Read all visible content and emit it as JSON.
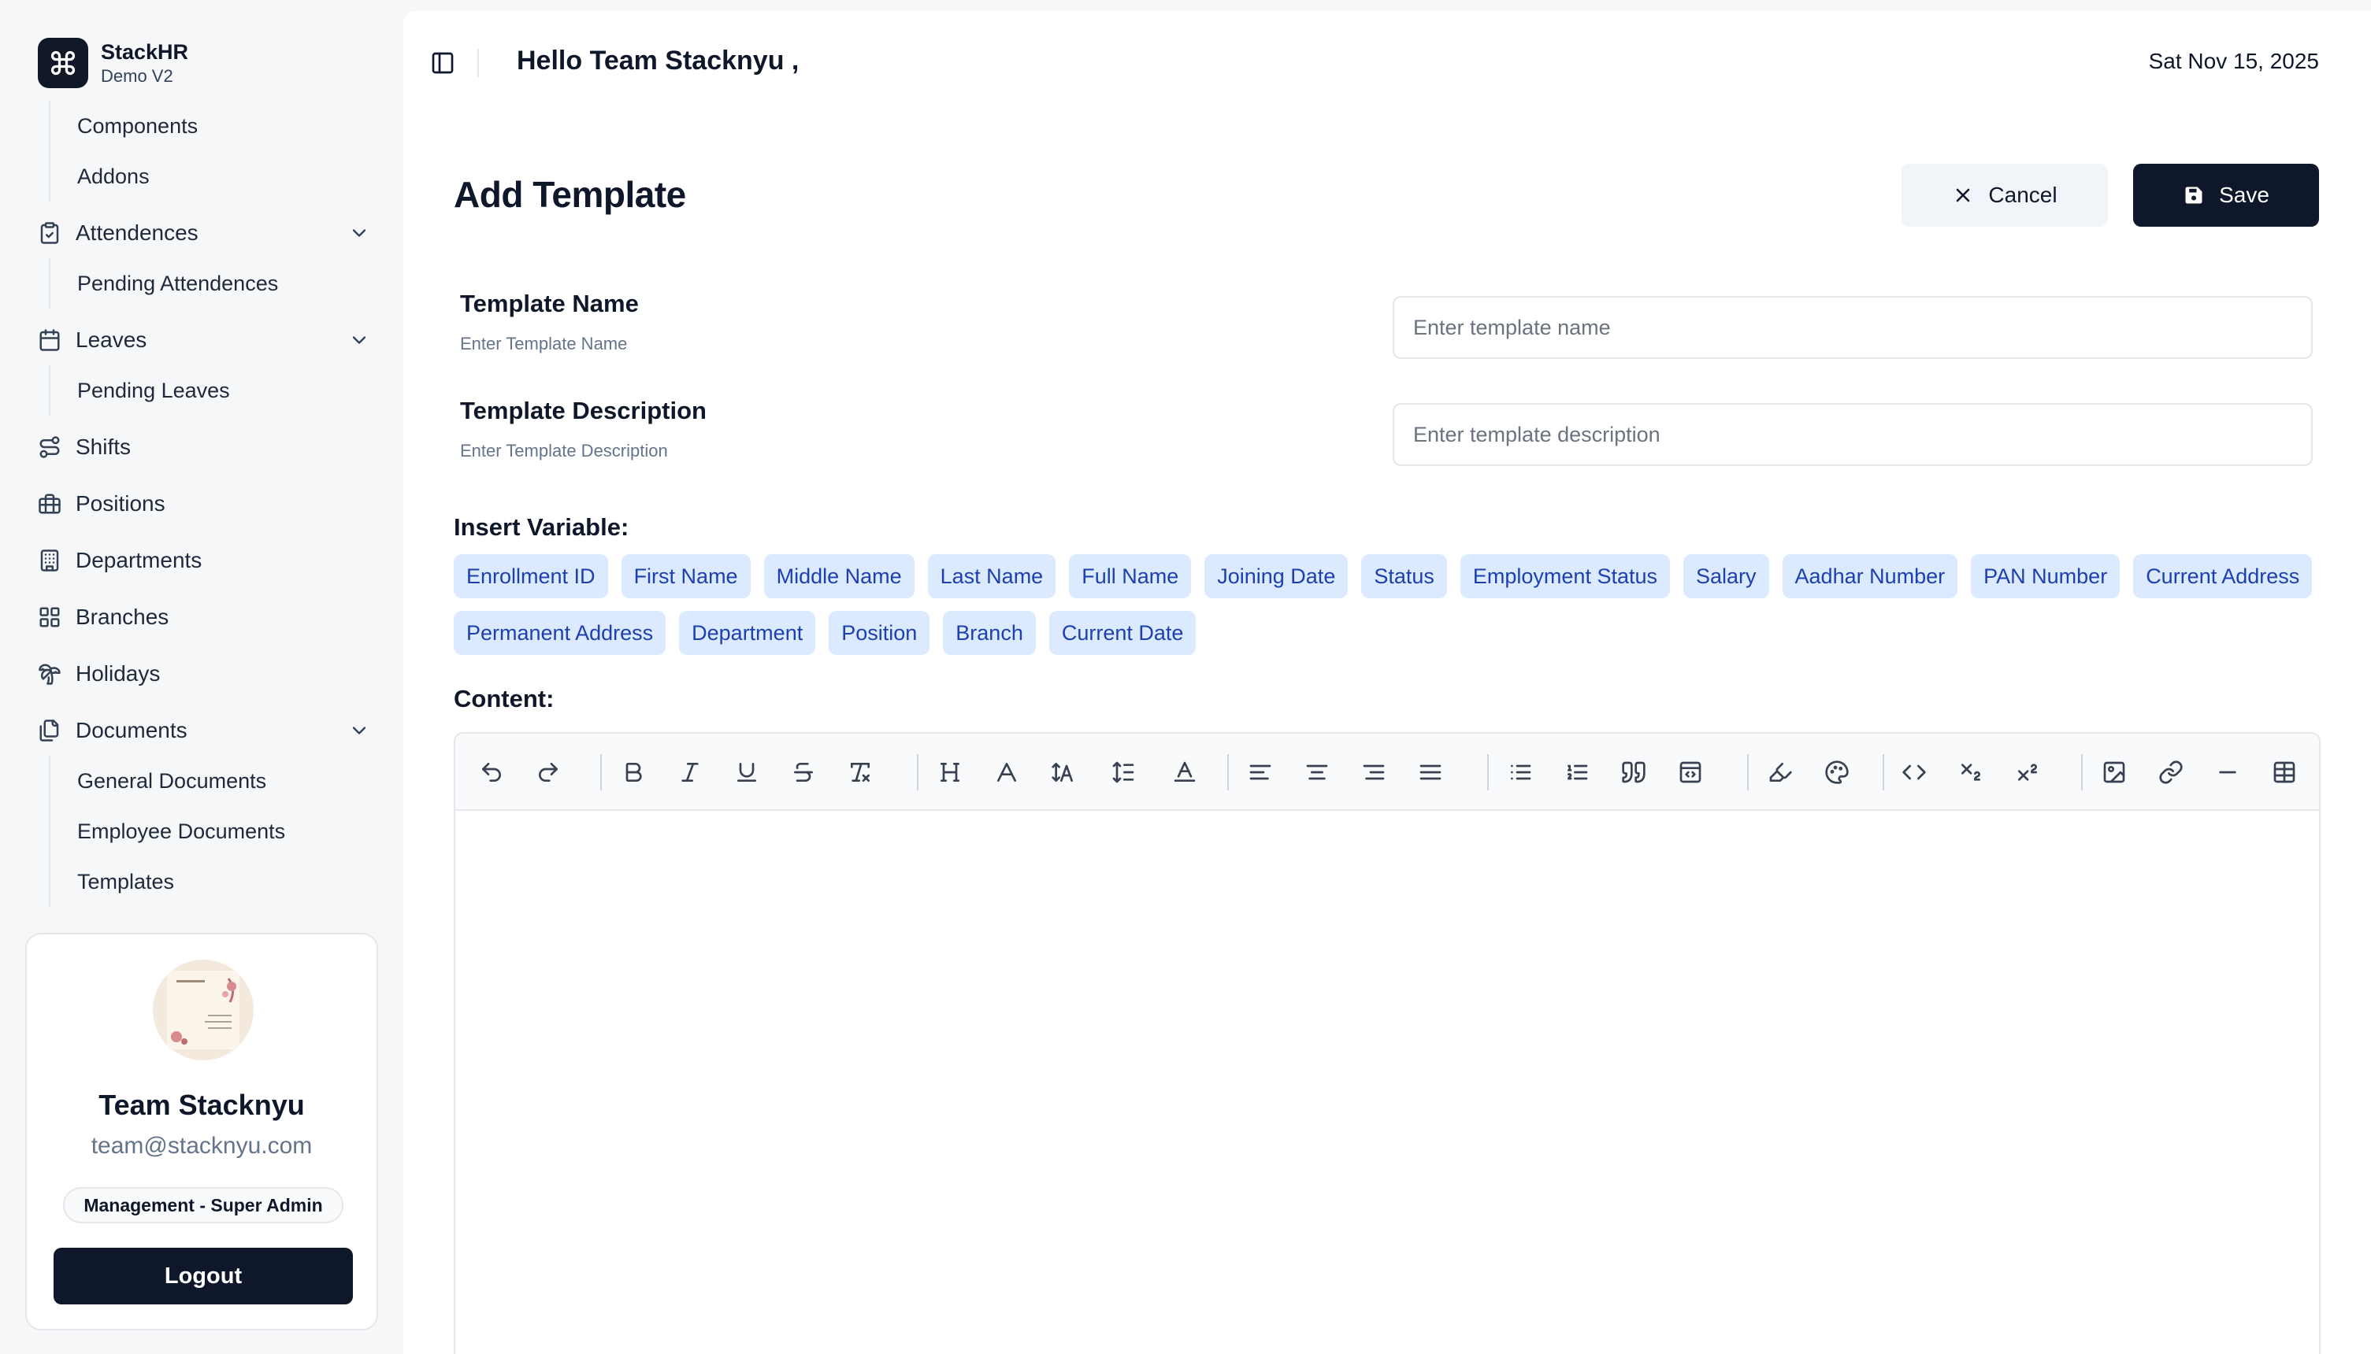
{
  "brand": {
    "name": "StackHR",
    "subtitle": "Demo V2"
  },
  "sidebar": {
    "top_subitems": [
      "Components",
      "Addons"
    ],
    "attendences": {
      "label": "Attendences",
      "subitems": [
        "Pending Attendences"
      ]
    },
    "leaves": {
      "label": "Leaves",
      "subitems": [
        "Pending Leaves"
      ]
    },
    "shifts": "Shifts",
    "positions": "Positions",
    "departments": "Departments",
    "branches": "Branches",
    "holidays": "Holidays",
    "documents": {
      "label": "Documents",
      "subitems": [
        "General Documents",
        "Employee Documents",
        "Templates"
      ]
    }
  },
  "user": {
    "name": "Team Stacknyu",
    "email": "team@stacknyu.com",
    "role": "Management - Super Admin",
    "logout_label": "Logout"
  },
  "topbar": {
    "greeting": "Hello Team Stacknyu ,",
    "date": "Sat Nov 15, 2025"
  },
  "page": {
    "title": "Add Template",
    "cancel_label": "Cancel",
    "save_label": "Save"
  },
  "form": {
    "name_label": "Template Name",
    "name_help": "Enter Template Name",
    "name_placeholder": "Enter template name",
    "name_value": "",
    "desc_label": "Template Description",
    "desc_help": "Enter Template Description",
    "desc_placeholder": "Enter template description",
    "desc_value": ""
  },
  "variables": {
    "label": "Insert Variable:",
    "items": [
      "Enrollment ID",
      "First Name",
      "Middle Name",
      "Last Name",
      "Full Name",
      "Joining Date",
      "Status",
      "Employment Status",
      "Salary",
      "Aadhar Number",
      "PAN Number",
      "Current Address",
      "Permanent Address",
      "Department",
      "Position",
      "Branch",
      "Current Date"
    ]
  },
  "content": {
    "label": "Content:",
    "value": ""
  },
  "toolbar_icons": [
    "undo-icon",
    "redo-icon",
    "bold-icon",
    "italic-icon",
    "underline-icon",
    "strikethrough-icon",
    "clear-format-icon",
    "heading-icon",
    "font-icon",
    "font-size-icon",
    "line-height-icon",
    "text-color-icon",
    "align-left-icon",
    "align-center-icon",
    "align-right-icon",
    "align-justify-icon",
    "bullet-list-icon",
    "numbered-list-icon",
    "blockquote-icon",
    "code-block-icon",
    "highlight-icon",
    "palette-icon",
    "inline-code-icon",
    "subscript-icon",
    "superscript-icon",
    "image-icon",
    "link-icon",
    "horizontal-rule-icon",
    "table-icon"
  ],
  "colors": {
    "primary": "#0f172a",
    "chip_bg": "#dbeafe",
    "chip_text": "#1e40af",
    "sidebar_bg": "#f6f7f9"
  }
}
